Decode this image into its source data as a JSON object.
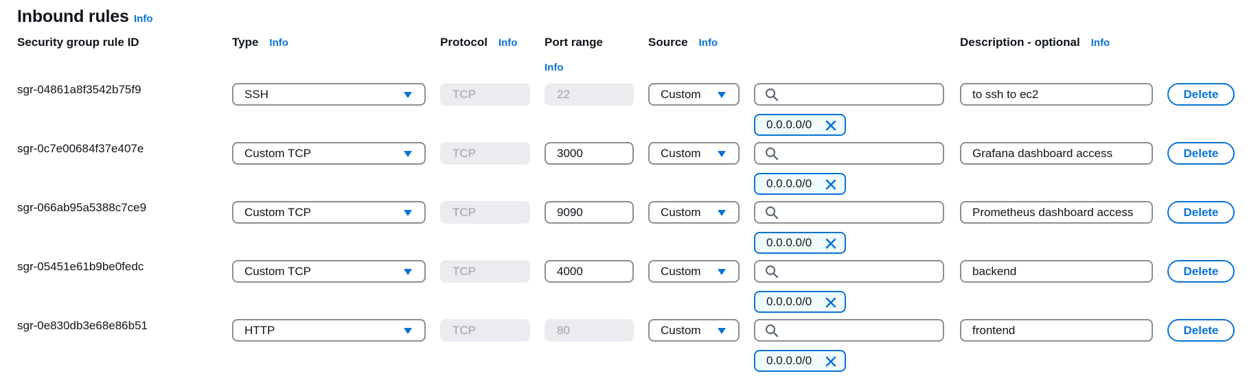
{
  "section": {
    "title": "Inbound rules",
    "title_info": "Info"
  },
  "headers": {
    "rule_id": "Security group rule ID",
    "type": "Type",
    "type_info": "Info",
    "protocol": "Protocol",
    "protocol_info": "Info",
    "port_range": "Port range",
    "port_range_info": "Info",
    "source": "Source",
    "source_info": "Info",
    "description": "Description - optional",
    "description_info": "Info"
  },
  "rules": [
    {
      "id": "sgr-04861a8f3542b75f9",
      "type": "SSH",
      "protocol": "TCP",
      "port": "22",
      "port_editable": false,
      "source": "Custom",
      "search": "",
      "cidr": "0.0.0.0/0",
      "description": "to ssh to ec2",
      "delete_label": "Delete"
    },
    {
      "id": "sgr-0c7e00684f37e407e",
      "type": "Custom TCP",
      "protocol": "TCP",
      "port": "3000",
      "port_editable": true,
      "source": "Custom",
      "search": "",
      "cidr": "0.0.0.0/0",
      "description": "Grafana dashboard access",
      "delete_label": "Delete"
    },
    {
      "id": "sgr-066ab95a5388c7ce9",
      "type": "Custom TCP",
      "protocol": "TCP",
      "port": "9090",
      "port_editable": true,
      "source": "Custom",
      "search": "",
      "cidr": "0.0.0.0/0",
      "description": "Prometheus dashboard access",
      "delete_label": "Delete"
    },
    {
      "id": "sgr-05451e61b9be0fedc",
      "type": "Custom TCP",
      "protocol": "TCP",
      "port": "4000",
      "port_editable": true,
      "source": "Custom",
      "search": "",
      "cidr": "0.0.0.0/0",
      "description": "backend",
      "delete_label": "Delete"
    },
    {
      "id": "sgr-0e830db3e68e86b51",
      "type": "HTTP",
      "protocol": "TCP",
      "port": "80",
      "port_editable": false,
      "source": "Custom",
      "search": "",
      "cidr": "0.0.0.0/0",
      "description": "frontend",
      "delete_label": "Delete"
    }
  ],
  "icons": {
    "dropdown": "caret-down-icon",
    "search": "search-icon",
    "remove_token": "close-icon"
  },
  "colors": {
    "accent": "#0972d3",
    "disabled_bg": "#ebebf0",
    "disabled_text": "#9ba0a8",
    "token_bg": "#f0fbff"
  }
}
